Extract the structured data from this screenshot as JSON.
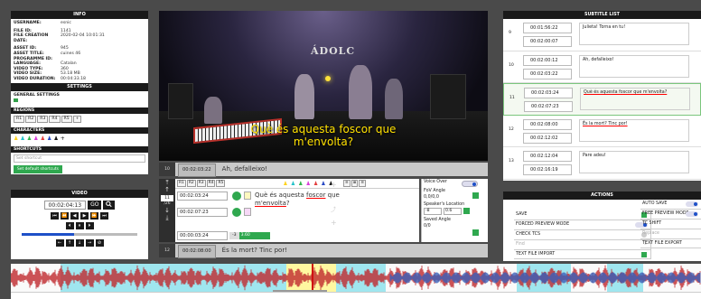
{
  "info": {
    "header": "INFO",
    "rows1": [
      {
        "k": "USERNAME:",
        "v": "esnic"
      }
    ],
    "rows2": [
      {
        "k": "FILE ID:",
        "v": "1141"
      },
      {
        "k": "FILE CREATION DATE:",
        "v": "2020-02-04 10:01:31"
      }
    ],
    "rows3": [
      {
        "k": "ASSET ID:",
        "v": "945"
      },
      {
        "k": "ASSET TITLE:",
        "v": "cuines 46"
      },
      {
        "k": "PROGRAMME ID:",
        "v": ""
      },
      {
        "k": "LANGUAGE:",
        "v": "Catalan"
      },
      {
        "k": "VIDEO TYPE:",
        "v": "360"
      },
      {
        "k": "VIDEO SIZE:",
        "v": "53.18 MB"
      },
      {
        "k": "VIDEO DURATION:",
        "v": "00:04:33.18"
      }
    ]
  },
  "settings": {
    "header": "SETTINGS",
    "general": "GENERAL SETTINGS",
    "regions_label": "REGIONS",
    "regions": [
      "R1",
      "R2",
      "R3",
      "R4",
      "R5",
      "+"
    ],
    "characters_label": "CHARACTERS",
    "characters": [
      {
        "glyph": "♟",
        "color": "#ffd21a"
      },
      {
        "glyph": "♟",
        "color": "#21c2c9"
      },
      {
        "glyph": "♟",
        "color": "#2fb34a"
      },
      {
        "glyph": "♟",
        "color": "#d93ad9"
      },
      {
        "glyph": "♟",
        "color": "#e33b3b"
      },
      {
        "glyph": "♟",
        "color": "#2446c4"
      },
      {
        "glyph": "♟",
        "color": "#111111"
      },
      {
        "glyph": "+",
        "color": "#111111"
      }
    ],
    "shortcuts_label": "SHORTCUTS",
    "shortcut_placeholder": "Set shortcut",
    "default_shortcuts": "Set default shortcuts"
  },
  "video_controls": {
    "header": "VIDEO",
    "time": "00:02:04:13",
    "go": "GO",
    "search_icon": "search-icon",
    "row1": [
      "⏮",
      "⏪",
      "◀",
      "▶",
      "⏩",
      "⏭"
    ],
    "row2": [
      "⏴",
      "⏸",
      "⏵"
    ],
    "row3": [
      "←",
      "↑",
      "↓",
      "→",
      "⊘"
    ],
    "progress": 0.45
  },
  "video": {
    "logo": "ÁDOLC",
    "subtitle_line1": "Què és aquesta foscor que",
    "subtitle_line2": "m'envolta?"
  },
  "prev_line": {
    "num": "10",
    "tc": "00:02:03:22",
    "text": "Ah, defalleixo!"
  },
  "editor": {
    "regions": [
      "R1",
      "R2",
      "R3",
      "R4",
      "R5"
    ],
    "num": "11",
    "count": "/26",
    "tc_in": "00:02:03:24",
    "tc_out": "00:02:07:23",
    "tc_dur": "00:00:03:24",
    "step": "-3",
    "dur_label": "3.60",
    "text_part1": "Què és aquesta ",
    "text_u1": "foscor",
    "text_part2": " que",
    "text_u2": "m'envolta",
    "text_part3": "?",
    "voice_over": "Voice Over",
    "fov_angle": "FoV Angle",
    "fov_value": "0,0/0,0",
    "speaker_location": "Speaker's Location",
    "loc_x": "-8",
    "loc_y": "0.6",
    "saved_angle": "Saved Angle",
    "saved_value": "0/0"
  },
  "next_line": {
    "num": "12",
    "tc": "00:02:08:00",
    "text": "És la mort? Tinc por!"
  },
  "subtitle_list": {
    "header": "SUBTITLE LIST",
    "items": [
      {
        "num": "9",
        "tc_in": "00:01:56:22",
        "tc_out": "00:02:00:07",
        "text": "Julieta! Torna en tu!"
      },
      {
        "num": "10",
        "tc_in": "00:02:00:12",
        "tc_out": "00:02:03:22",
        "text": "Ah, defalleixo!"
      },
      {
        "num": "11",
        "tc_in": "00:02:03:24",
        "tc_out": "00:02:07:23",
        "text": "Què és aquesta foscor que m'envolta?"
      },
      {
        "num": "12",
        "tc_in": "00:02:08:00",
        "tc_out": "00:02:12:02",
        "text": "És la mort? Tinc por!"
      },
      {
        "num": "13",
        "tc_in": "00:02:12:04",
        "tc_out": "00:02:16:19",
        "text": "Pare adeu!"
      }
    ]
  },
  "actions": {
    "header": "ACTIONS",
    "save": "SAVE",
    "auto_save": "AUTO SAVE",
    "forced_preview": "FORCED PREVIEW MODE",
    "free_preview": "FREE PREVIEW MODE",
    "check_tcs": "CHECK TCS",
    "tc_shift": "TC SHIFT",
    "find": "Find",
    "replace": "Replace",
    "import": "TEXT FILE IMPORT",
    "export": "TEXT FILE EXPORT"
  },
  "colors": {
    "accent_blue": "#1e50c8",
    "green": "#2fa84f",
    "subtitle_yellow": "#ffe000",
    "wave_region": "#9fe6ef",
    "wave_region_yellow": "#fff8a0",
    "wave_red": "#c0282e",
    "wave_blue": "#3a5fb8"
  }
}
